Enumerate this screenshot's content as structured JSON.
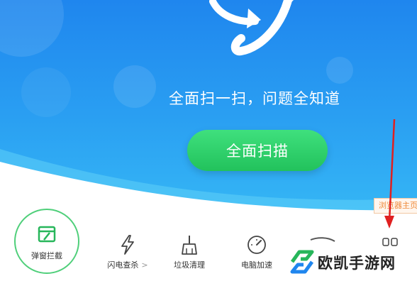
{
  "hero": {
    "slogan": "全面扫一扫，问题全知道",
    "scan_button": "全面扫描"
  },
  "side_tag": "浏览器主页",
  "popup_block": {
    "label": "弹窗拦截",
    "icon": "popup-window-icon"
  },
  "tools": [
    {
      "label": "闪电查杀",
      "suffix": ">",
      "icon": "lightning-icon"
    },
    {
      "label": "垃圾清理",
      "icon": "broom-icon"
    },
    {
      "label": "电脑加速",
      "icon": "speedometer-icon"
    }
  ],
  "watermark": {
    "text": "欧凯手游网"
  },
  "colors": {
    "hero_blue": "#1f86ee",
    "scan_green": "#22c25c",
    "arrow_red": "#e02020",
    "tag_orange": "#ef8a3b"
  }
}
